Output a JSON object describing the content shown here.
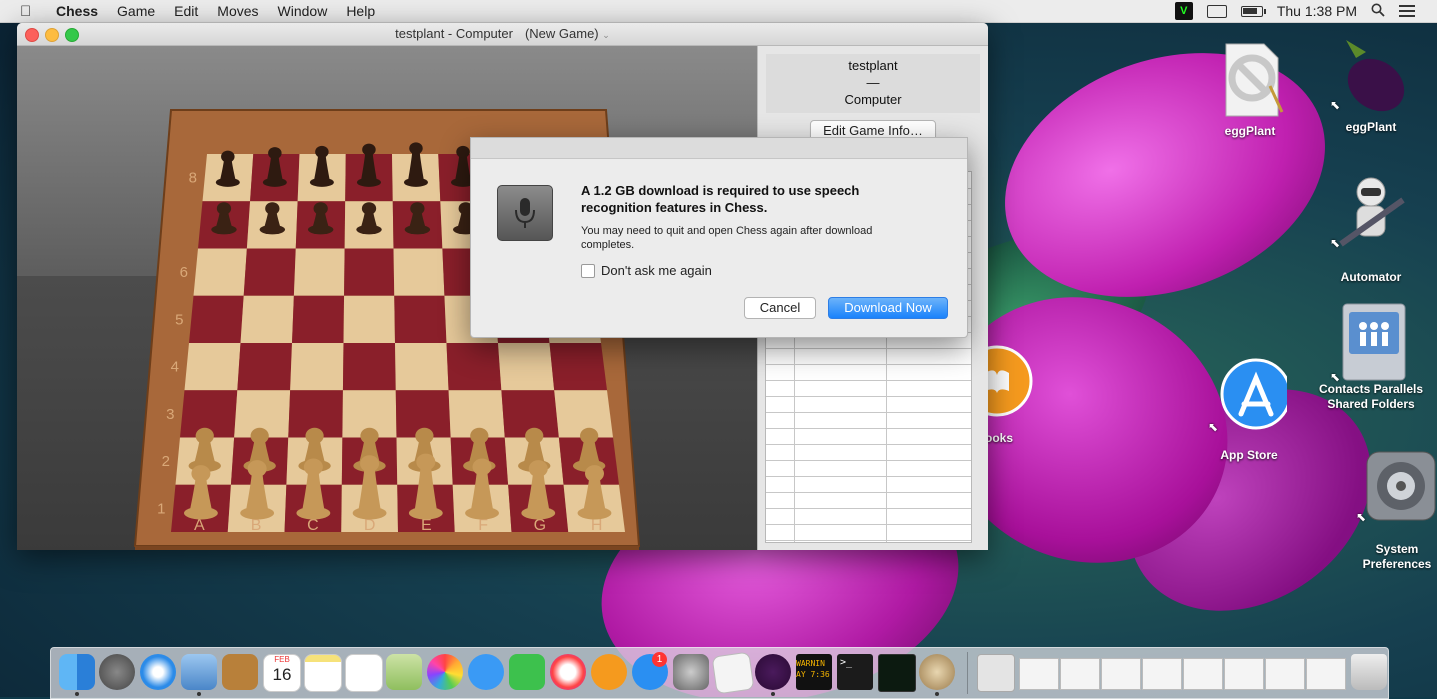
{
  "menubar": {
    "app_name": "Chess",
    "items": [
      "Game",
      "Edit",
      "Moves",
      "Window",
      "Help"
    ],
    "clock": "Thu 1:38 PM",
    "status_letter": "V"
  },
  "window": {
    "title": "testplant - Computer",
    "subtitle": "(New Game)",
    "chevron": "⌄"
  },
  "side_panel": {
    "player_white": "testplant",
    "separator": "—",
    "player_black": "Computer",
    "edit_button": "Edit Game Info…"
  },
  "board": {
    "files": [
      "A",
      "B",
      "C",
      "D",
      "E",
      "F",
      "G",
      "H"
    ],
    "ranks": [
      "8",
      "6",
      "5",
      "4",
      "3",
      "2",
      "1"
    ]
  },
  "dialog": {
    "heading": "A 1.2 GB download is required to use speech recognition features in Chess.",
    "body": "You may need to quit and open Chess again after download completes.",
    "checkbox_label": "Don't ask me again",
    "cancel": "Cancel",
    "download": "Download Now"
  },
  "desktop": {
    "icons": [
      {
        "label": "eggPlant"
      },
      {
        "label": "eggPlant"
      },
      {
        "label": "Automator"
      },
      {
        "label": "Contacts Parallels Shared Folders"
      },
      {
        "label": "App Store"
      },
      {
        "label": "System Preferences"
      },
      {
        "label": "ooks"
      }
    ]
  },
  "dock": {
    "calendar_month": "FEB",
    "calendar_day": "16",
    "appstore_badge": "1",
    "console_text": "WARNIN AY 7:36"
  },
  "colors": {
    "accent": "#1a82fb",
    "board_dark": "#8a1f2a",
    "board_light": "#e6c99a",
    "frame": "#a8683a"
  }
}
